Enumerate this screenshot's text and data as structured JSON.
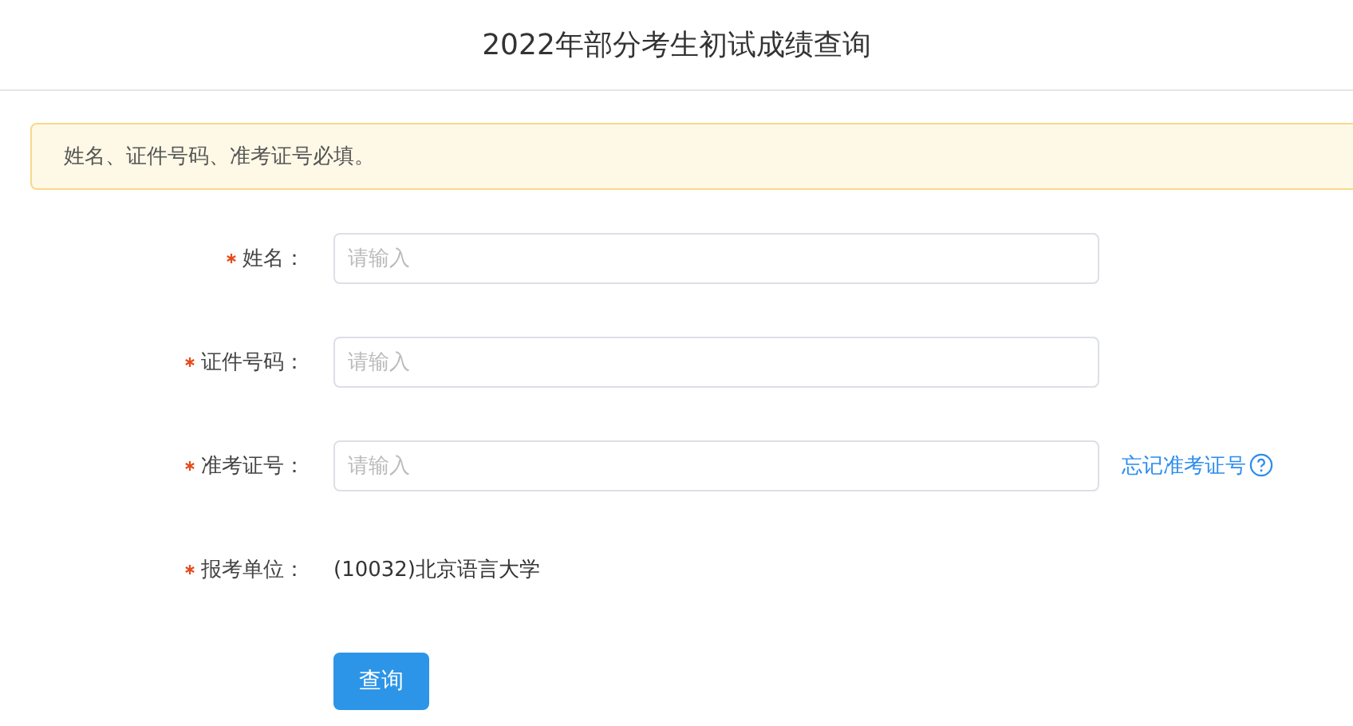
{
  "title": "2022年部分考生初试成绩查询",
  "alert": {
    "text": "姓名、证件号码、准考证号必填。"
  },
  "fields": [
    {
      "kind": "input",
      "label": "姓名：",
      "required": true,
      "placeholder": "请输入"
    },
    {
      "kind": "input",
      "label": "证件号码：",
      "required": true,
      "placeholder": "请输入"
    },
    {
      "kind": "input",
      "label": "准考证号：",
      "required": true,
      "placeholder": "请输入",
      "link": "忘记准考证号"
    },
    {
      "kind": "text",
      "label": "报考单位：",
      "required": true,
      "value": "(10032)北京语言大学"
    }
  ],
  "submit": {
    "label": "查询"
  }
}
